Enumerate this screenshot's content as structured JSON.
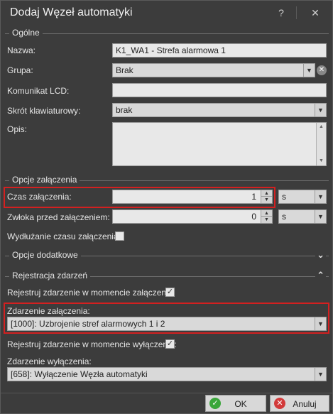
{
  "window": {
    "title": "Dodaj Węzeł automatyki",
    "help_label": "?",
    "close_label": "✕"
  },
  "general": {
    "section_label": "Ogólne",
    "name_label": "Nazwa:",
    "name_value": "K1_WA1 - Strefa alarmowa 1",
    "group_label": "Grupa:",
    "group_value": "Brak",
    "lcd_label": "Komunikat LCD:",
    "lcd_value": "",
    "shortcut_label": "Skrót klawiaturowy:",
    "shortcut_value": "brak",
    "description_label": "Opis:",
    "description_value": ""
  },
  "activation": {
    "section_label": "Opcje załączenia",
    "time_label": "Czas załączenia:",
    "time_value": "1",
    "time_unit": "s",
    "delay_label": "Zwłoka przed załączeniem:",
    "delay_value": "0",
    "delay_unit": "s",
    "extend_label": "Wydłużanie czasu załączenia:",
    "extend_checked": false
  },
  "additional": {
    "section_label": "Opcje dodatkowe"
  },
  "events": {
    "section_label": "Rejestracja zdarzeń",
    "register_on_label": "Rejestruj zdarzenie w momencie załączenia:",
    "register_on_checked": true,
    "on_event_label": "Zdarzenie załączenia:",
    "on_event_value": "[1000]: Uzbrojenie stref alarmowych 1 i 2",
    "register_off_label": "Rejestruj zdarzenie w momencie  wyłączenia:",
    "register_off_checked": true,
    "off_event_label": "Zdarzenie wyłączenia:",
    "off_event_value": "[658]: Wyłączenie Węzła automatyki"
  },
  "footer": {
    "ok_label": "OK",
    "cancel_label": "Anuluj"
  },
  "colors": {
    "background": "#3c3c3c",
    "highlight": "#d32020",
    "ok_icon": "#3aa63a",
    "cancel_icon": "#d23a3a"
  }
}
